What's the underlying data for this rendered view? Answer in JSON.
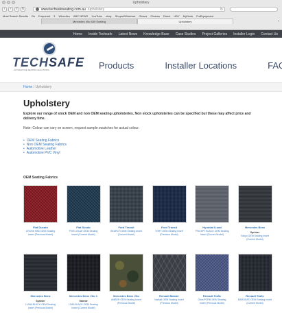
{
  "browser": {
    "window_title": "Upholstery",
    "url": "www.techsafeseating.com.au",
    "url_path": "/upholstery",
    "bookmarks": [
      "Most Search Results",
      "Gs",
      "Emprendi",
      "3",
      "Wheelies",
      "ABC NEWS",
      "YouTube",
      "ebay",
      "Shops4Windows",
      "Gtrees",
      "Gtnews",
      "Direct",
      "UBY",
      "MyDesk",
      "FutEquipment"
    ],
    "tabs": [
      "Mercedes Vito 639 Seating",
      "Upholstery"
    ]
  },
  "site_nav": {
    "items": [
      "Home",
      "Inside Techsafe",
      "Latest News",
      "Knowledge Base",
      "Case Studies",
      "Project Galleries",
      "Installer Login",
      "Contact Us"
    ]
  },
  "header": {
    "logo_main": "TECH",
    "logo_accent": "SAFE",
    "logo_tagline": "AUTOMOTIVE SEATING SOLUTIONS",
    "menu": [
      "Products",
      "Installer Locations",
      "FAQs"
    ]
  },
  "breadcrumb": {
    "home": "Home",
    "separator": " / ",
    "current": "Upholstery"
  },
  "page": {
    "title": "Upholstery",
    "intro": "Explore our range of stock OEM and non OEM seating upholsteries. Non stock upholsteries can be specified but these may affect price and delivery time.",
    "note": "Note: Colour can vary on screen, request sample swatches for actual colour.",
    "links": [
      "OEM Seating Fabrics",
      "Non OEM Seating Fabrics",
      "Automotive Leather",
      "Automotive PVC Vinyl"
    ],
    "section_heading": "OEM Seating Fabrics"
  },
  "swatches": [
    {
      "title": "Fiat Ducato",
      "desc": "CROSS RED OEM Seating Insert (Previous Model)",
      "sub": "",
      "color": "#8b1a22",
      "pattern": "weave"
    },
    {
      "title": "Fiat Scudo",
      "desc": "PIXEL BLUE OEM Seating Insert (Current Model)",
      "sub": "",
      "color": "#1f3b52",
      "pattern": "weave"
    },
    {
      "title": "Ford Transit",
      "desc": "SEARCH OEM Seating Insert (Current Model)",
      "sub": "",
      "color": "#3a4350",
      "pattern": "fine"
    },
    {
      "title": "Ford Transit",
      "desc": "TORY OEM Seating Insert (Previous Model)",
      "sub": "",
      "color": "#1c2b48",
      "pattern": "fine"
    },
    {
      "title": "Hyundai iLoad",
      "desc": "TRICKPT BLACK OEM Seating Insert (Current Model)",
      "sub": "",
      "color": "#585c66",
      "pattern": "stripe"
    },
    {
      "title": "Mercedes Benz",
      "desc": "Tolkyo OEM Seating Insert (Current Model)",
      "sub": "Sprinter",
      "color": "#2e3136",
      "pattern": "stripe"
    },
    {
      "title": "Mercedes Benz",
      "desc": "LUMA BLACK OEM Seating Insert (Previous Model)",
      "sub": "Sprinter",
      "color": "#23262c",
      "pattern": "stripe"
    },
    {
      "title": "Mercedes Benz Vito 1",
      "desc": "LIMA BLACK OEM Seating Insert (Current Model)",
      "sub": "Valente",
      "color": "#1a1c22",
      "pattern": "fine"
    },
    {
      "title": "Mercedes Benz Vito",
      "desc": "AMBER OEM Seating Insert (Previous Model)",
      "sub": "",
      "color": "#4a4f3a",
      "pattern": "camo"
    },
    {
      "title": "Renault Master",
      "desc": "Nathalt OEM Seating Insert (Previous Model)",
      "sub": "",
      "color": "#3b3e44",
      "pattern": "hex"
    },
    {
      "title": "Renault Trafic",
      "desc": "Olive/FORM OEM Seating Insert (Previous Model)",
      "sub": "",
      "color": "#4e5a8a",
      "pattern": "weave"
    },
    {
      "title": "Renault Trafic",
      "desc": "BAROSATI OEM Seating Insert (Current Model)",
      "sub": "",
      "color": "#262a33",
      "pattern": "fine"
    }
  ]
}
